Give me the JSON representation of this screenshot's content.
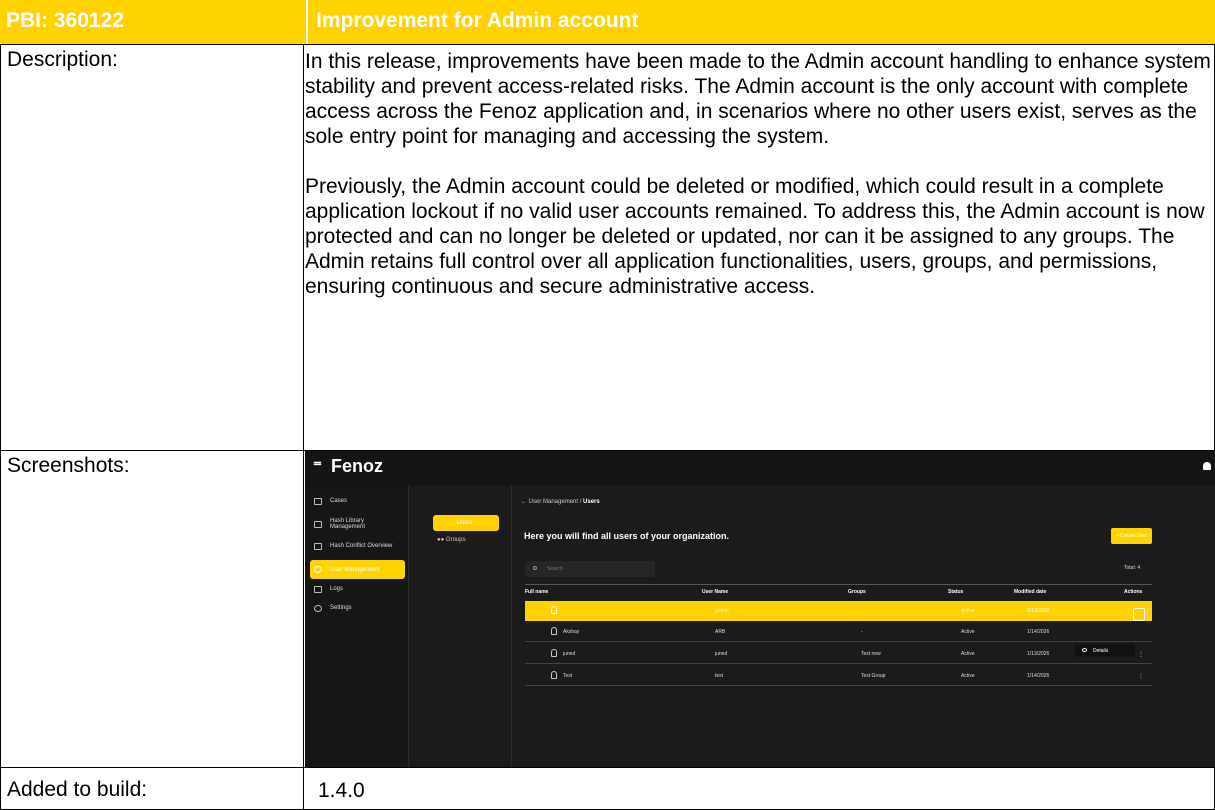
{
  "header": {
    "pbi": "PBI: 360122",
    "title": "Improvement for Admin account"
  },
  "description": {
    "label": "Description:",
    "paragraphs": [
      "In this release, improvements have been made to the Admin account handling to enhance system stability and prevent access-related risks. The Admin account is the only account with complete access across the Fenoz application and, in scenarios where no other users exist, serves as the sole entry point for managing and accessing the system.",
      "Previously, the Admin account could be deleted or modified, which could result in a complete application lockout if no valid user accounts remained. To address this, the Admin account is now protected and can no longer be deleted or updated, nor can it be assigned to any groups. The Admin retains full control over all application functionalities, users, groups, and permissions, ensuring continuous and secure administrative access."
    ]
  },
  "screenshots": {
    "label": "Screenshots:",
    "app": {
      "logo": "Fenoz",
      "accent_color": "#FFD200",
      "sidebar": [
        {
          "label": "Cases",
          "icon": "folder-icon"
        },
        {
          "label": "Hash Library Management",
          "icon": "library-icon"
        },
        {
          "label": "Hash Conflict Overview",
          "icon": "conflict-icon"
        },
        {
          "label": "User Management",
          "icon": "user-icon"
        },
        {
          "label": "Logs",
          "icon": "file-icon"
        },
        {
          "label": "Settings",
          "icon": "gear-icon"
        }
      ],
      "subnav": {
        "users": "Users",
        "groups": "Groups"
      },
      "breadcrumb": {
        "parent": "User Management",
        "separator": "/",
        "current": "Users"
      },
      "heading": "Here you will find all users of your organization.",
      "create_button": "+ Create User",
      "search_placeholder": "Search",
      "total": "Total: 4",
      "columns": [
        "Full name",
        "User Name",
        "Groups",
        "Status",
        "Modified date",
        "Actions"
      ],
      "rows": [
        {
          "full_name": "",
          "user_name": "admin",
          "groups": "-",
          "status": "Active",
          "modified": "1/13/2026"
        },
        {
          "full_name": "Akshay",
          "user_name": "ARB",
          "groups": "-",
          "status": "Active",
          "modified": "1/14/2026"
        },
        {
          "full_name": "juned",
          "user_name": "juned",
          "groups": "Test new",
          "status": "Active",
          "modified": "1/13/2026"
        },
        {
          "full_name": "Test",
          "user_name": "test",
          "groups": "Test Group",
          "status": "Active",
          "modified": "1/14/2026"
        }
      ],
      "actions_menu": {
        "details": "Details"
      }
    }
  },
  "build": {
    "label": "Added to build:",
    "value": "1.4.0"
  }
}
